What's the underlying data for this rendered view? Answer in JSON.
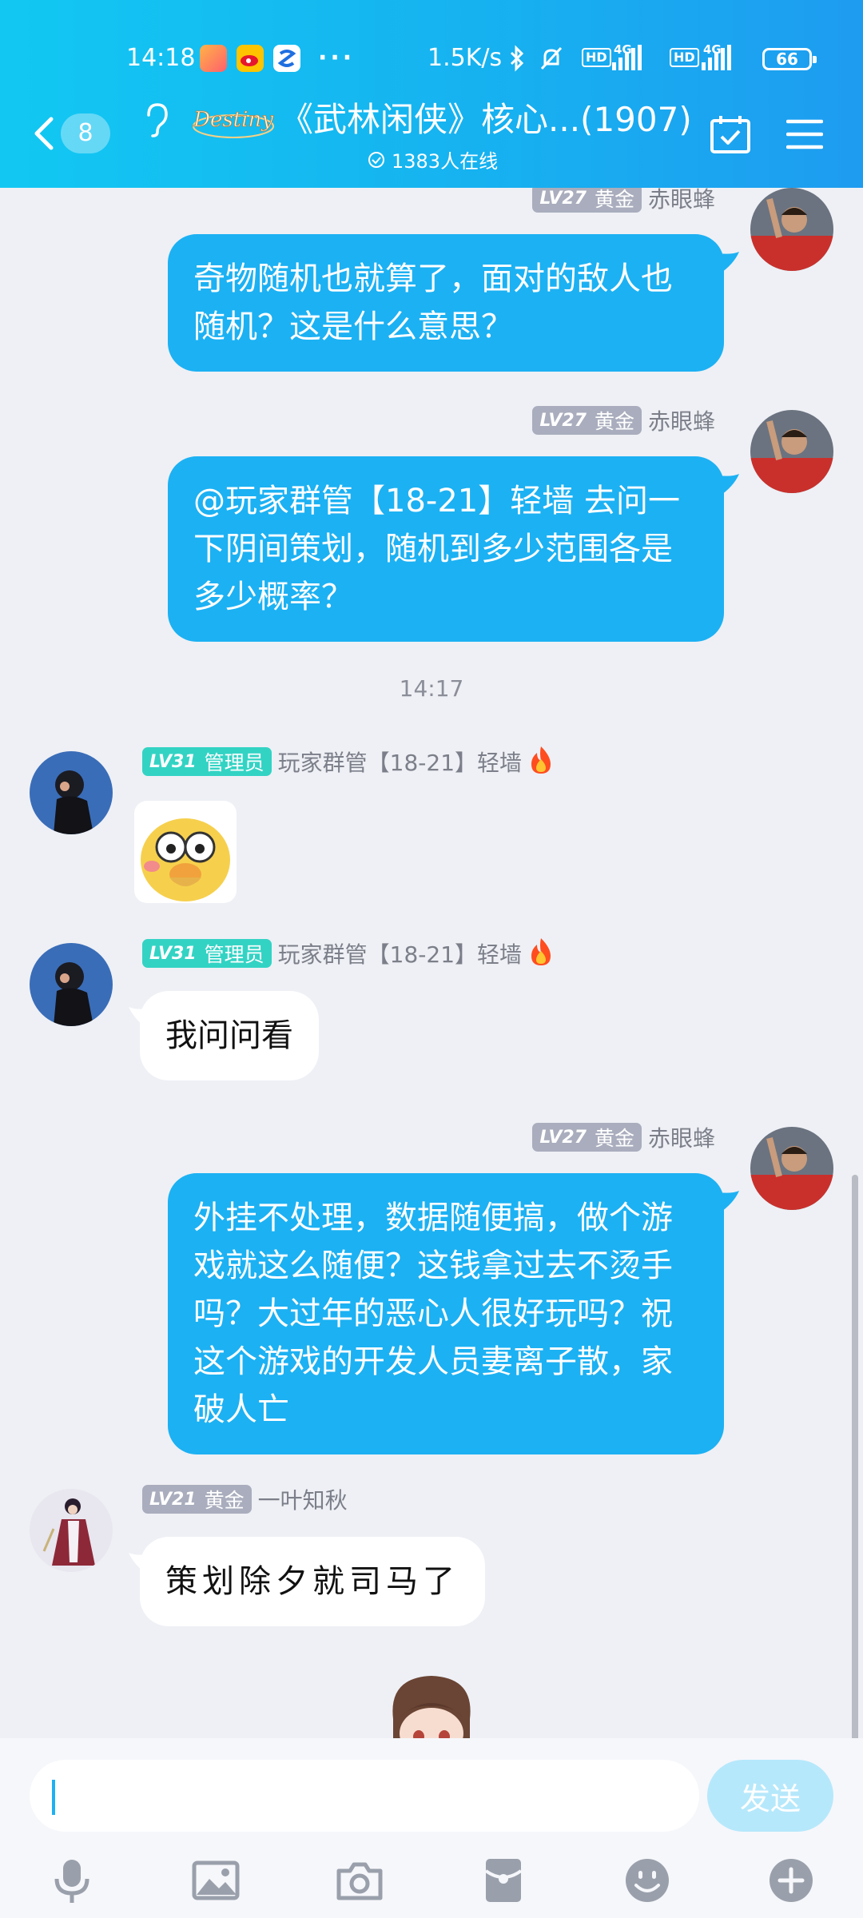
{
  "status_bar": {
    "time": "14:18",
    "more": "···",
    "net_speed": "1.5K/s",
    "sim1_label": "4G",
    "sim2_label": "4G",
    "hd_label": "HD",
    "battery": "66"
  },
  "header": {
    "back_badge": "8",
    "logo_text": "Destiny",
    "group_title": "《武林闲侠》核心...(1907)",
    "online": "1383人在线"
  },
  "messages": [
    {
      "side": "right",
      "level": "LV27",
      "title": "黄金",
      "name": "赤眼蜂",
      "text": "奇物随机也就算了，面对的敌人也随机？这是什么意思？"
    },
    {
      "side": "right",
      "level": "LV27",
      "title": "黄金",
      "name": "赤眼蜂",
      "text": "@玩家群管【18-21】轻墙 去问一下阴间策划，随机到多少范围各是多少概率？"
    },
    {
      "side": "left",
      "level": "LV31",
      "title": "管理员",
      "name": "玩家群管【18-21】轻墙",
      "sticker": "duck-sticker"
    },
    {
      "side": "left",
      "level": "LV31",
      "title": "管理员",
      "name": "玩家群管【18-21】轻墙",
      "text": "我问问看"
    },
    {
      "side": "right",
      "level": "LV27",
      "title": "黄金",
      "name": "赤眼蜂",
      "text": "外挂不处理，数据随便搞，做个游戏就这么随便？这钱拿过去不烫手吗？大过年的恶心人很好玩吗？祝这个游戏的开发人员妻离子散，家破人亡"
    },
    {
      "side": "left",
      "level": "LV21",
      "title": "黄金",
      "name": "一叶知秋",
      "text": "策划除夕就司马了"
    }
  ],
  "time_divider": "14:17",
  "input": {
    "send_label": "发送",
    "value": ""
  },
  "toolbar": [
    "mic-icon",
    "image-icon",
    "camera-icon",
    "red-packet-icon",
    "emoji-icon",
    "plus-icon"
  ],
  "colors": {
    "header_start": "#12c8f2",
    "bubble_self": "#1cb1f3",
    "admin_badge": "#33d3c4",
    "gold_badge": "#a9adbd"
  }
}
